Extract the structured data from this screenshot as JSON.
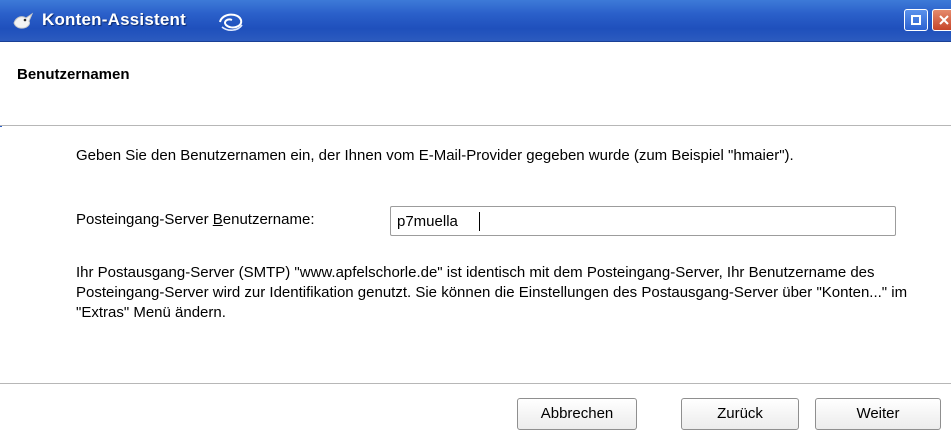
{
  "window": {
    "title": "Konten-Assistent",
    "app_icon": "thunderbird-icon",
    "controls": [
      "restore-icon",
      "close-icon"
    ]
  },
  "header": {
    "section_title": "Benutzernamen"
  },
  "main": {
    "intro_text": "Geben Sie den Benutzernamen ein, der Ihnen vom E-Mail-Provider gegeben wurde (zum Beispiel \"hmaier\").",
    "username_label_prefix": "Posteingang-Server ",
    "username_label_mnemonic": "B",
    "username_label_suffix": "enutzername:",
    "username_value": "p7muella",
    "info_text": "Ihr Postausgang-Server (SMTP) \"www.apfelschorle.de\" ist identisch mit dem Posteingang-Server, Ihr Benutzername des Posteingang-Server wird zur Identifikation genutzt. Sie können die Einstellungen des Postausgang-Server über \"Konten...\" im \"Extras\" Menü ändern."
  },
  "footer": {
    "cancel_label": "Abbrechen",
    "back_label": "Zurück",
    "next_label": "Weiter"
  },
  "colors": {
    "titlebar": "#2a5fc9",
    "titlebar_text": "#ffffff"
  }
}
